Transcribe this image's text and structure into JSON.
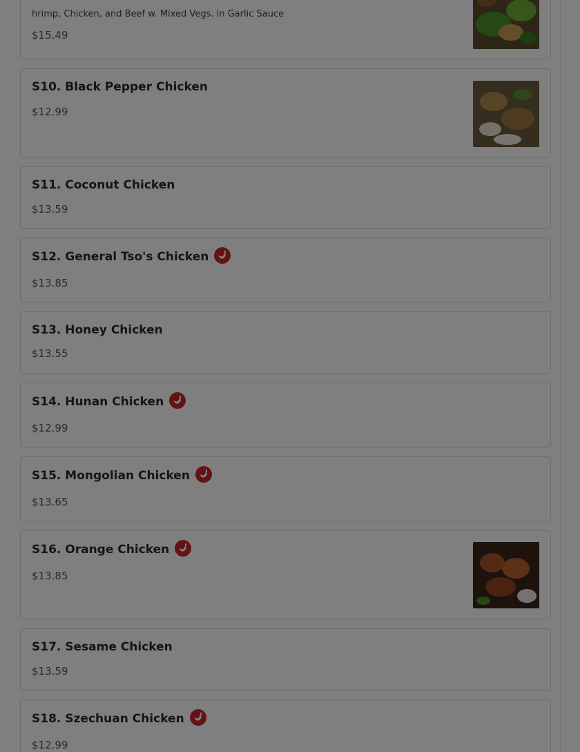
{
  "items": [
    {
      "desc": "hrimp, Chicken, and Beef w. Mixed Vegs. in Garlic Sauce",
      "price": "$15.49",
      "photo": "dish-photo-mixed"
    },
    {
      "name": "S10. Black Pepper Chicken",
      "price": "$12.99",
      "photo": "dish-photo-black-pepper-chicken"
    },
    {
      "name": "S11. Coconut Chicken",
      "price": "$13.59"
    },
    {
      "name": "S12. General Tso's Chicken",
      "price": "$13.85",
      "spicy": true
    },
    {
      "name": "S13. Honey Chicken",
      "price": "$13.55"
    },
    {
      "name": "S14. Hunan Chicken",
      "price": "$12.99",
      "spicy": true
    },
    {
      "name": "S15. Mongolian Chicken",
      "price": "$13.65",
      "spicy": true
    },
    {
      "name": "S16. Orange Chicken",
      "price": "$13.85",
      "spicy": true,
      "photo": "dish-photo-orange-chicken"
    },
    {
      "name": "S17. Sesame Chicken",
      "price": "$13.59"
    },
    {
      "name": "S18. Szechuan Chicken",
      "price": "$12.99",
      "spicy": true
    }
  ],
  "colors": {
    "spicy_badge": "#c8262b",
    "overlay": "rgba(0,0,0,0.5)"
  }
}
